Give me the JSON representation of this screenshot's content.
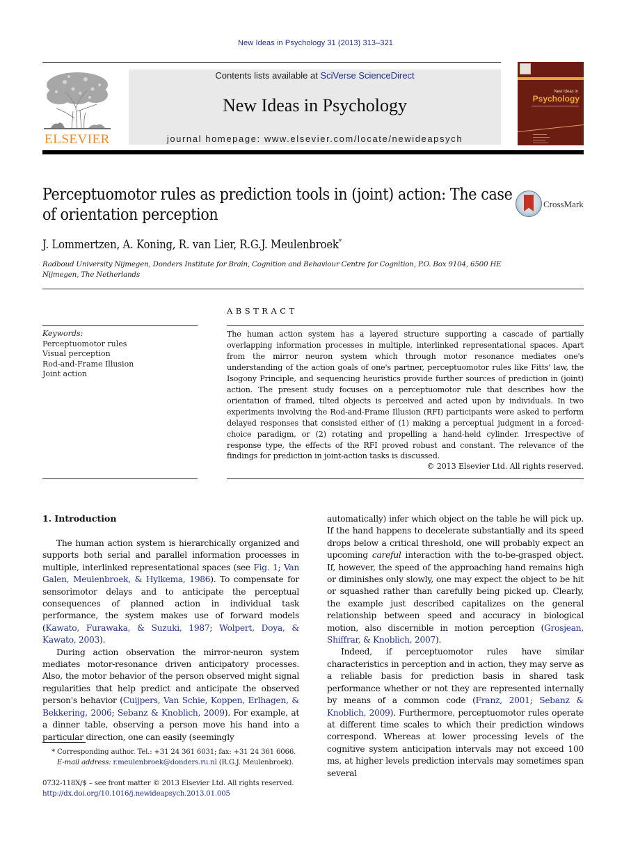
{
  "running_head": "New Ideas in Psychology 31 (2013) 313–321",
  "header": {
    "publisher_logo_text": "ELSEVIER",
    "contents_prefix": "Contents lists available at ",
    "contents_link": "SciVerse ScienceDirect",
    "journal_title": "New Ideas in Psychology",
    "homepage_label": "journal homepage: ",
    "homepage_url": "www.elsevier.com/locate/newideapsych",
    "cover": {
      "line1": "New Ideas in",
      "line2": "Psychology"
    },
    "colors": {
      "link": "#1f2f8a",
      "elsevier_orange": "#f28a21",
      "cover_bg": "#6b1d12",
      "banner_bg": "#e9e9e9"
    }
  },
  "article": {
    "title": "Perceptuomotor rules as prediction tools in (joint) action: The case of orientation perception",
    "crossmark_label": "CrossMark",
    "authors": "J. Lommertzen, A. Koning, R. van Lier, R.G.J. Meulenbroek",
    "corresponding_marker": "*",
    "affiliation": "Radboud University Nijmegen, Donders Institute for Brain, Cognition and Behaviour Centre for Cognition, P.O. Box 9104, 6500 HE Nijmegen, The Netherlands"
  },
  "keywords": {
    "label": "Keywords:",
    "items": [
      "Perceptuomotor rules",
      "Visual perception",
      "Rod-and-Frame Illusion",
      "Joint action"
    ]
  },
  "abstract": {
    "heading": "ABSTRACT",
    "text": "The human action system has a layered structure supporting a cascade of partially overlapping information processes in multiple, interlinked representational spaces. Apart from the mirror neuron system which through motor resonance mediates one's understanding of the action goals of one's partner, perceptuomotor rules like Fitts' law, the Isogony Principle, and sequencing heuristics provide further sources of prediction in (joint) action. The present study focuses on a perceptuomotor rule that describes how the orientation of framed, tilted objects is perceived and acted upon by individuals. In two experiments involving the Rod-and-Frame Illusion (RFI) participants were asked to perform delayed responses that consisted either of (1) making a perceptual judgment in a forced-choice paradigm, or (2) rotating and propelling a hand-held cylinder. Irrespective of response type, the effects of the RFI proved robust and constant. The relevance of the findings for prediction in joint-action tasks is discussed.",
    "copyright": "© 2013 Elsevier Ltd. All rights reserved."
  },
  "intro": {
    "heading": "1.  Introduction",
    "p1": {
      "t1": "The human action system is hierarchically organized and supports both serial and parallel information processes in multiple, interlinked representational spaces (see ",
      "l1": "Fig. 1",
      "t2": "; ",
      "l2": "Van Galen, Meulenbroek, & Hylkema, 1986",
      "t3": "). To compensate for sensorimotor delays and to anticipate the perceptual consequences of planned action in individual task performance, the system makes use of forward models (",
      "l3": "Kawato, Furawaka, & Suzuki, 1987",
      "t4": "; ",
      "l4": "Wolpert, Doya, & Kawato, 2003",
      "t5": ")."
    },
    "p2": {
      "t1": "During action observation the mirror-neuron system mediates motor-resonance driven anticipatory processes. Also, the motor behavior of the person observed might signal regularities that help predict and anticipate the observed person's behavior (",
      "l1": "Cuijpers, Van Schie, Koppen, Erlhagen, & Bekkering, 2006",
      "t2": "; ",
      "l2": "Sebanz & Knoblich, 2009",
      "t3": "). For example, at a dinner table, observing a person move his hand into a particular direction, one can easily (seemingly automatically) infer which object on the table he will pick up. If the hand happens to decelerate substantially and its speed drops below a critical threshold, one will probably expect an upcoming ",
      "em": "careful",
      "t4": " interaction with the to-be-grasped object. If, however, the speed of the approaching hand remains high or diminishes only slowly, one may expect the object to be hit or squashed rather than carefully being picked up. Clearly, the example just described capitalizes on the general relationship between speed and accuracy in biological motion, also discernible in motion perception (",
      "l3": "Grosjean, Shiffrar, & Knoblich, 2007",
      "t5": ")."
    },
    "p3": {
      "t1": "Indeed, if perceptuomotor rules have similar characteristics in perception and in action, they may serve as a reliable basis for prediction basis in shared task performance whether or not they are represented internally by means of a common code (",
      "l1": "Franz, 2001",
      "t2": "; ",
      "l2": "Sebanz & Knoblich, 2009",
      "t3": "). Furthermore, perceptuomotor rules operate at different time scales to which their prediction windows correspond. Whereas at lower processing levels of the cognitive system anticipation intervals may not exceed 100 ms, at higher levels prediction intervals may sometimes span several"
    }
  },
  "footnote": {
    "marker": "*",
    "text": "Corresponding author. Tel.: +31 24 361 6031; fax: +31 24 361 6066.",
    "email_label": "E-mail address: ",
    "email": "r.meulenbroek@donders.ru.nl",
    "email_suffix": " (R.G.J. Meulenbroek)."
  },
  "front_matter": {
    "issn_line": "0732-118X/$ – see front matter © 2013 Elsevier Ltd. All rights reserved.",
    "doi": "http://dx.doi.org/10.1016/j.newideapsych.2013.01.005"
  }
}
